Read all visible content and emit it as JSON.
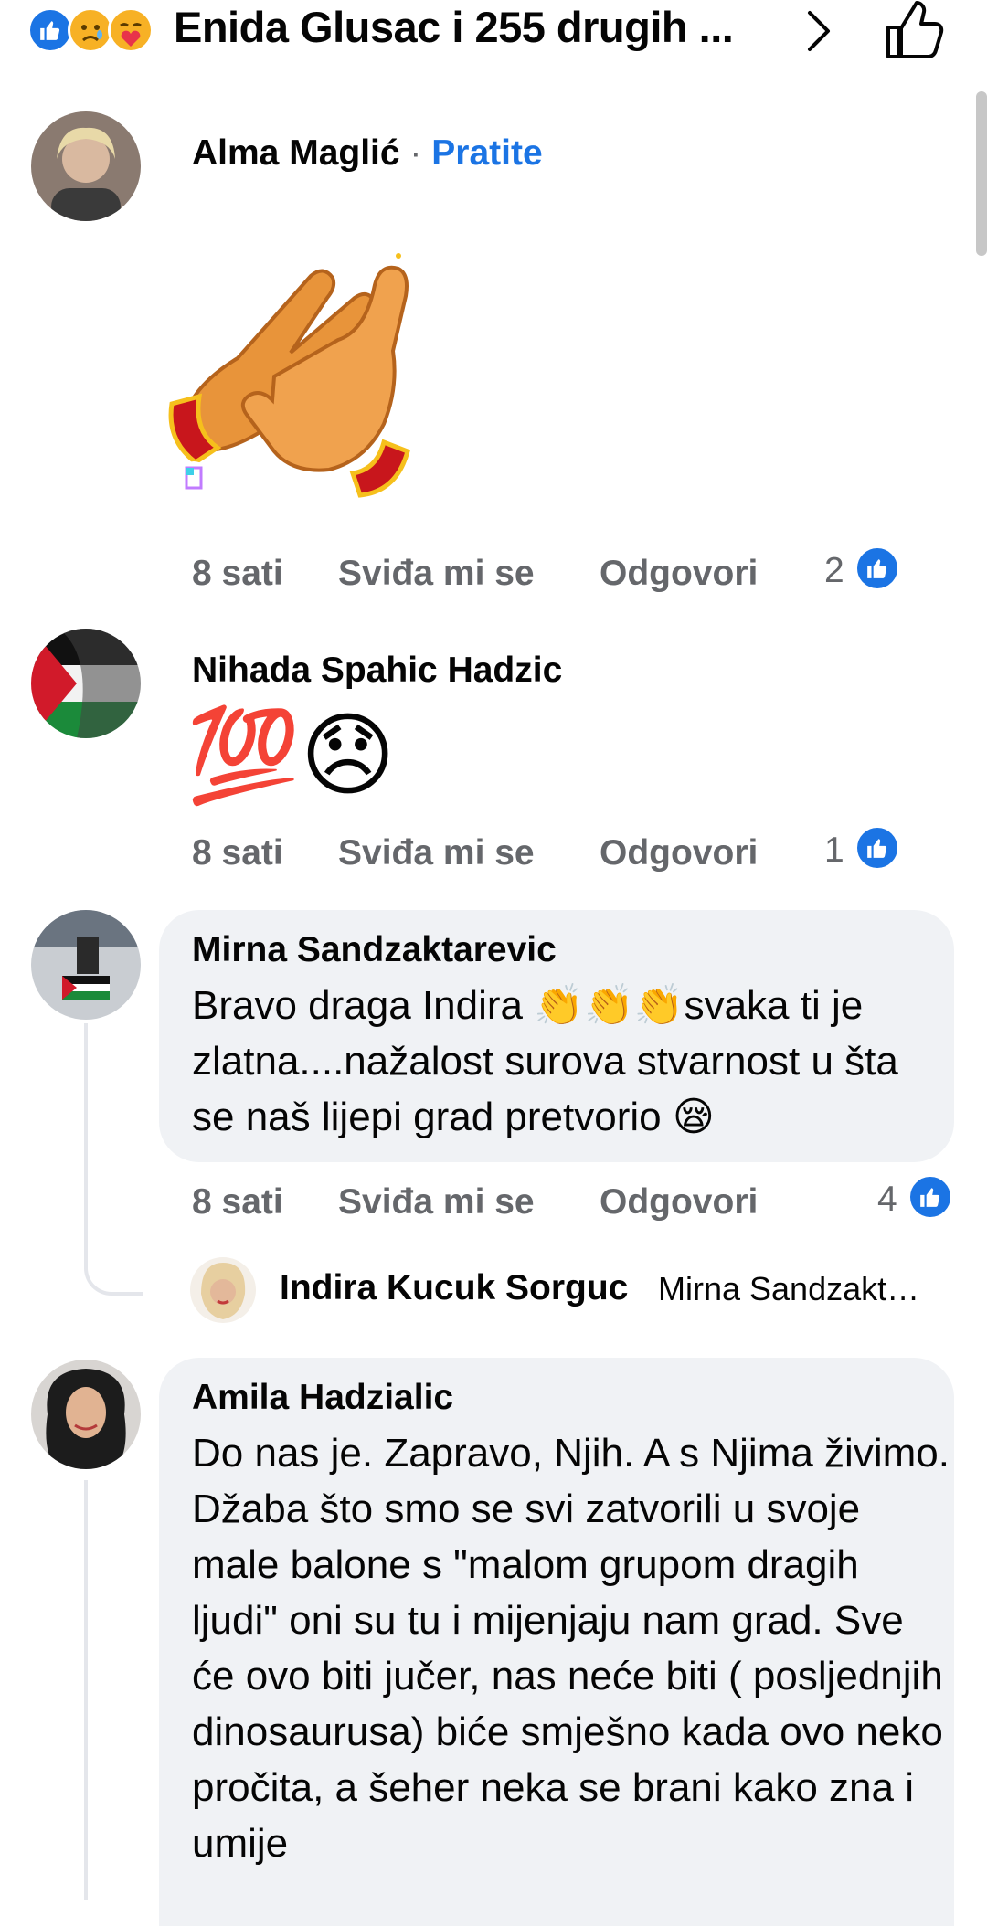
{
  "header": {
    "title": "Enida Glusac i 255 drugih ...",
    "reactions": [
      "like-icon",
      "sad-icon",
      "care-icon"
    ],
    "accent": "#1b74e4"
  },
  "comments": [
    {
      "name": "Alma Maglić",
      "follow_label": "Pratite",
      "attachment": "clapping-hands-sticker",
      "time": "8 sati",
      "like_label": "Sviđa mi se",
      "reply_label": "Odgovori",
      "likes": "2"
    },
    {
      "name": "Nihada Spahic Hadzic",
      "emoji_text": "💯😞",
      "time": "8 sati",
      "like_label": "Sviđa mi se",
      "reply_label": "Odgovori",
      "likes": "1"
    },
    {
      "name": "Mirna Sandzaktarevic",
      "text": "Bravo draga Indira 👏👏👏svaka ti je zlatna....nažalost surova stvarnost u šta se naš lijepi grad pretvorio 😪",
      "time": "8 sati",
      "like_label": "Sviđa mi se",
      "reply_label": "Odgovori",
      "likes": "4",
      "reply_preview": {
        "name": "Indira Kucuk Sorguc",
        "snippet": "Mirna Sandzakt…"
      }
    },
    {
      "name": "Amila Hadzialic",
      "text": "Do nas je. Zapravo, Njih. A s Njima živimo. Džaba što smo se svi zatvorili u svoje male balone s \"malom grupom dragih ljudi\" oni su tu i mijenjaju nam grad. Sve će ovo biti jučer, nas neće biti ( posljednjih dinosaurusa) biće smješno kada ovo neko pročita,  a šeher neka se brani kako zna i umije"
    }
  ]
}
